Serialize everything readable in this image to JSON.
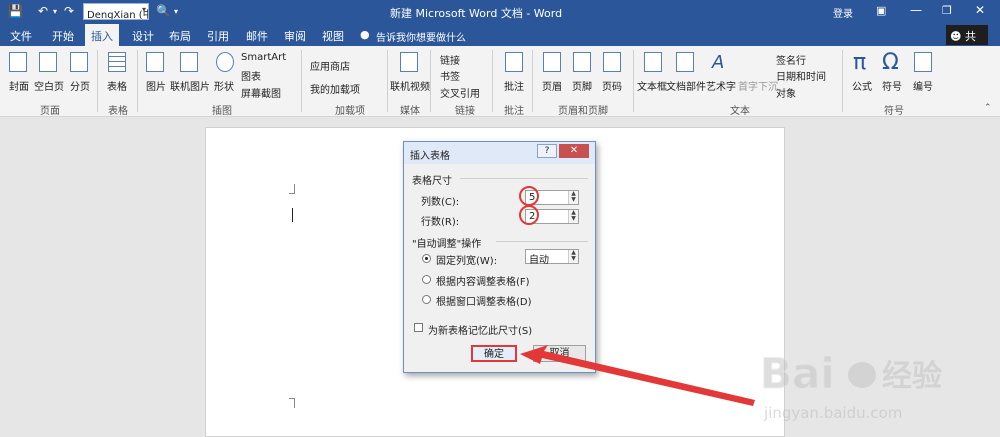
{
  "window": {
    "title": "新建 Microsoft Word 文档 - Word",
    "font_box": "DengXian (中",
    "login": "登录"
  },
  "tabs": [
    "文件",
    "开始",
    "插入",
    "设计",
    "布局",
    "引用",
    "邮件",
    "审阅",
    "视图"
  ],
  "tell_me": "告诉我你想要做什么",
  "share": "共享",
  "ribbon": {
    "items": {
      "cover": "封面",
      "blank": "空白页",
      "break": "分页",
      "table": "表格",
      "picture": "图片",
      "online_pic": "联机图片",
      "shapes": "形状",
      "smartart": "SmartArt",
      "chart": "图表",
      "screenshot": "屏幕截图",
      "store": "应用商店",
      "addins": "我的加载项",
      "online_video": "联机视频",
      "link": "链接",
      "bookmark": "书签",
      "xref": "交叉引用",
      "comment": "批注",
      "header": "页眉",
      "footer": "页脚",
      "pagenum": "页码",
      "textbox": "文本框",
      "docparts": "文档部件",
      "wordart": "艺术字",
      "dropcap": "首字下沉",
      "signature": "签名行",
      "datetime": "日期和时间",
      "object": "对象",
      "equation": "公式",
      "symbol": "符号",
      "number": "编号"
    },
    "groups": {
      "pages": "页面",
      "tables": "表格",
      "illustrations": "插图",
      "addins": "加载项",
      "media": "媒体",
      "links": "链接",
      "comments": "批注",
      "headerfooter": "页眉和页脚",
      "text": "文本",
      "symbols": "符号"
    }
  },
  "dialog": {
    "title": "插入表格",
    "help": "?",
    "section_size": "表格尺寸",
    "columns_label": "列数(C):",
    "columns_value": "5",
    "rows_label": "行数(R):",
    "rows_value": "2",
    "section_autofit": "\"自动调整\"操作",
    "fixed_label": "固定列宽(W):",
    "fixed_value": "自动",
    "autofit_content": "根据内容调整表格(F)",
    "autofit_window": "根据窗口调整表格(D)",
    "remember": "为新表格记忆此尺寸(S)",
    "ok": "确定",
    "cancel": "取消"
  },
  "colors": {
    "word_blue": "#2b579a",
    "highlight_red": "#e23838"
  },
  "watermark": {
    "brand": "Bai经验",
    "url": "jingyan.baidu.com"
  }
}
